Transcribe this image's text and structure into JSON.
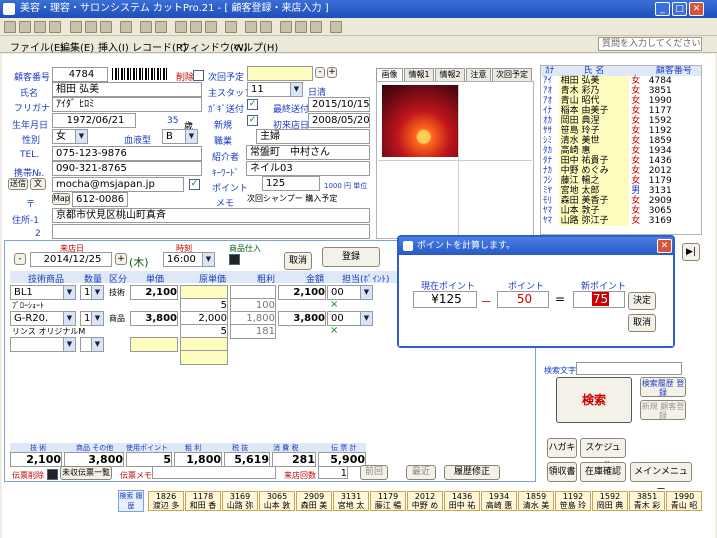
{
  "window": {
    "title": "美容・理容・サロンシステム カットPro.21 - [ 顧客登録・来店入力 ]"
  },
  "menubar": {
    "items": [
      "ファイル(E)",
      "編集(E)",
      "挿入(I)",
      "レコード(R)",
      "ウィンドウ(W)",
      "ヘルプ(H)"
    ],
    "help_placeholder": "質問を入力してください"
  },
  "customer": {
    "no_label": "顧客番号",
    "no": "4784",
    "delete_label": "削除",
    "name_label": "氏名",
    "name": "相田 弘美",
    "kana_label": "フリガナ",
    "kana": "ｱｲﾀﾞ ﾋﾛﾐ",
    "birth_label": "生年月日",
    "birth": "1972/06/21",
    "age": "35",
    "age_unit": "歳",
    "sex_label": "性別",
    "sex": "女",
    "blood_label": "血液型",
    "blood": "B",
    "tel_label": "TEL.",
    "tel": "075-123-9876",
    "mobile_label": "携帯№.",
    "mobile": "090-321-8765",
    "mail_btn1": "送信",
    "mail_btn2": "文",
    "email": "mocha@msjapan.jp",
    "zip_label": "〒",
    "map_btn": "Map",
    "zip": "612-0086",
    "addr1_label": "住所-1",
    "addr1": "京都市伏見区桃山町真斉",
    "addr2_label": "2",
    "addr2": ""
  },
  "right_info": {
    "next_label": "次回予定",
    "next": "",
    "staff_label": "主スタッフ",
    "staff": "11",
    "staff_name": "日清",
    "dm_label": "ｶﾞｷﾞ送付",
    "last_label": "最終送付",
    "last": "2015/10/15",
    "new_label": "新規",
    "first_label": "初来店日",
    "first": "2008/05/20",
    "job_label": "職業",
    "job": "主婦",
    "intro_label": "紹介者",
    "intro": "常盤町　中村さん",
    "keyword_label": "ｷｰﾜｰﾄﾞ",
    "keyword": "ネイル03",
    "point_label": "ポイント",
    "point": "125",
    "point_note": "1000 円 単位",
    "memo_label": "メモ",
    "memo": "次回シャンプー 購入予定"
  },
  "tabs": [
    "画像",
    "情報1",
    "情報2",
    "注意",
    "次回予定"
  ],
  "visit": {
    "date_label": "来店日",
    "date": "2014/12/25",
    "weekday": "(木)",
    "time_label": "時刻",
    "time": "16:00",
    "product_label": "商品仕入",
    "cancel": "取消",
    "register": "登録",
    "headers": [
      "技術商品",
      "数量",
      "区分",
      "単価",
      "原単価",
      "粗利",
      "金額",
      "担当(ﾎﾟｲﾝﾄ)"
    ],
    "rows": [
      {
        "item": "BL1",
        "qty": "1",
        "cat": "技術",
        "price": "2,100",
        "cost": "",
        "profit": "",
        "amount": "2,100",
        "staff": "00"
      },
      {
        "item": "ﾌﾞﾛｰｼｮｰﾄ",
        "qty": "",
        "cat": "",
        "price": "",
        "cost": "5",
        "profit": "100",
        "amount": "",
        "staff": "×"
      },
      {
        "item": "G-R20.",
        "qty": "1",
        "cat": "商品",
        "price": "3,800",
        "cost": "2,000",
        "profit": "1,800",
        "amount": "3,800",
        "staff": "00"
      },
      {
        "item": "リンス オリジナルM",
        "qty": "",
        "cat": "",
        "price": "",
        "cost": "5",
        "profit": "181",
        "amount": "",
        "staff": "×"
      }
    ],
    "tot_headers": [
      "技 術",
      "商品 その他",
      "使用ポイント",
      "粗 利",
      "税 抜",
      "消 費 税",
      "伝 票 計"
    ],
    "totals": [
      "2,100",
      "3,800",
      "5",
      "1,800",
      "5,619",
      "281",
      "5,900"
    ],
    "slip_delete": "伝票削除",
    "unsettled": "未収伝票一覧",
    "slip_memo_label": "伝票メモ",
    "visits_label": "来店回数",
    "visits": "1",
    "prev": "前回",
    "latest": "最近",
    "history": "履歴修正"
  },
  "customer_list": {
    "headers": [
      "ｶﾅ",
      "氏 名",
      "",
      "顧客番号"
    ],
    "rows": [
      [
        "ｱｲ",
        "相田 弘美",
        "女",
        "4784"
      ],
      [
        "ｱｵ",
        "青木 彩乃",
        "女",
        "3851"
      ],
      [
        "ｱｵ",
        "青山 昭代",
        "女",
        "1990"
      ],
      [
        "ｲﾅ",
        "稲本 由美子",
        "女",
        "1177"
      ],
      [
        "ｵｶ",
        "岡田 典涅",
        "女",
        "1592"
      ],
      [
        "ｻｻ",
        "笹島 玲子",
        "女",
        "1192"
      ],
      [
        "ｼﾐ",
        "清水 美世",
        "女",
        "1859"
      ],
      [
        "ﾀｶ",
        "高崎 惠",
        "女",
        "1934"
      ],
      [
        "ﾀﾅ",
        "田中 祐貴子",
        "女",
        "1436"
      ],
      [
        "ﾅｶ",
        "中野 めぐみ",
        "女",
        "2012"
      ],
      [
        "ﾌｼ",
        "藤江 暢之",
        "女",
        "1179"
      ],
      [
        "ﾐﾔ",
        "宮地 太郎",
        "男",
        "3131"
      ],
      [
        "ﾓﾘ",
        "森田 美香子",
        "女",
        "2909"
      ],
      [
        "ﾔﾏ",
        "山本 敦子",
        "女",
        "3065"
      ],
      [
        "ﾔﾏ",
        "山路 弥江子",
        "女",
        "3169"
      ]
    ]
  },
  "side_panel": {
    "search_label": "検索文字",
    "search_value": "",
    "search_btn": "検索",
    "history_btn": "検索履歴 登録",
    "new_history_btn": "新規 顧客登録",
    "postcard": "ハガキ",
    "schedule": "スケジュール",
    "receipt": "領収書",
    "stock": "在庫確認",
    "menu": "メインメニュー"
  },
  "bottom": {
    "label": "検索 履歴",
    "items": [
      {
        "no": "1826",
        "name": "渡辺 多"
      },
      {
        "no": "1178",
        "name": "和田 香"
      },
      {
        "no": "3169",
        "name": "山路 弥"
      },
      {
        "no": "3065",
        "name": "山本 敦"
      },
      {
        "no": "2909",
        "name": "森田 美"
      },
      {
        "no": "3131",
        "name": "宮地 太"
      },
      {
        "no": "1179",
        "name": "藤江 暢"
      },
      {
        "no": "2012",
        "name": "中野 め"
      },
      {
        "no": "1436",
        "name": "田中 祐"
      },
      {
        "no": "1934",
        "name": "高崎 惠"
      },
      {
        "no": "1859",
        "name": "清水 美"
      },
      {
        "no": "1192",
        "name": "笹島 玲"
      },
      {
        "no": "1592",
        "name": "岡田 典"
      },
      {
        "no": "3851",
        "name": "青木 彩"
      },
      {
        "no": "1990",
        "name": "青山 昭"
      }
    ]
  },
  "dialog": {
    "title": "ポイントを計算します。",
    "current_label": "現在ポイント",
    "current": "¥125",
    "minus": "－",
    "point_label": "ポイント",
    "point": "50",
    "equals": "=",
    "new_label": "新ポイント",
    "new": "75",
    "ok": "決定",
    "cancel": "取消",
    "close": "✕"
  }
}
